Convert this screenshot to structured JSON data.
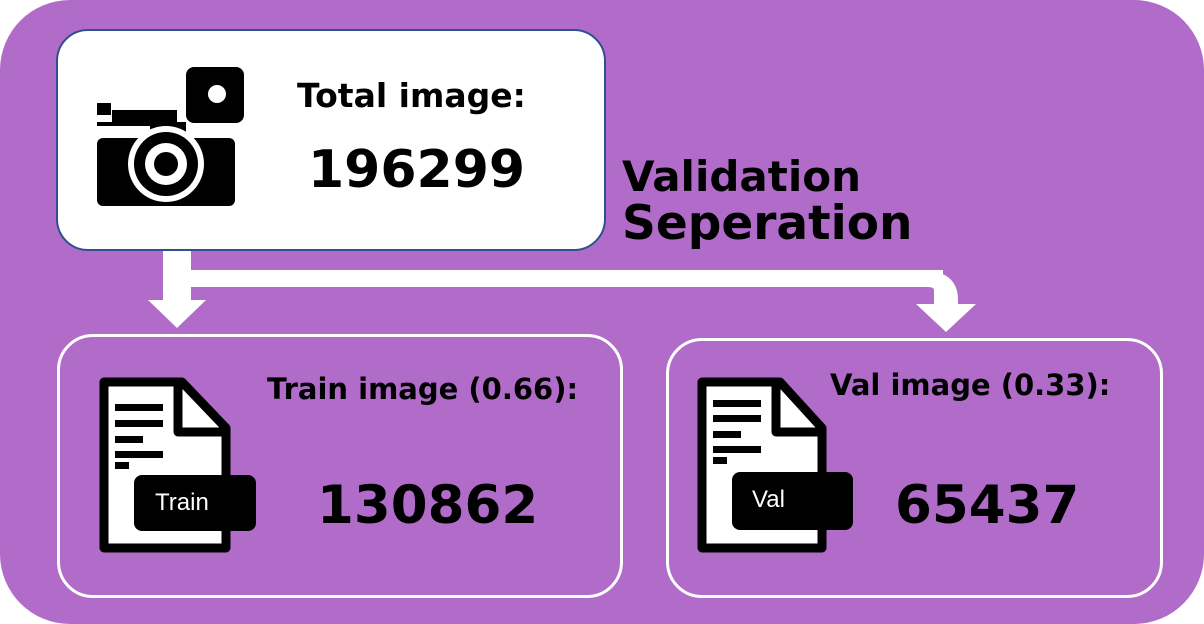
{
  "total": {
    "label": "Total image:",
    "value": "196299"
  },
  "title": {
    "line1": "Validation",
    "line2": "Seperation"
  },
  "train": {
    "label": "Train image (0.66):",
    "value": "130862",
    "tag": "Train"
  },
  "val": {
    "label": "Val image (0.33):",
    "value": "65437",
    "tag": "Val"
  },
  "colors": {
    "background": "#b06cc8",
    "box_border": "#2f4f8f",
    "arrow": "#ffffff"
  },
  "icons": [
    "camera-icon",
    "train-document-icon",
    "val-document-icon"
  ]
}
